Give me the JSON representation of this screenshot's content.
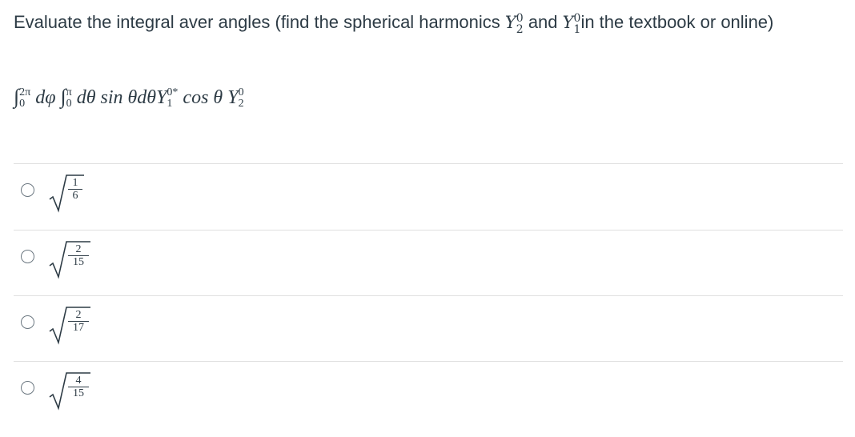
{
  "question": {
    "text_before": "Evaluate the integral aver angles (find the spherical harmonics ",
    "y2": "Y",
    "y2_sup": "0",
    "y2_sub": "2",
    "and": " and ",
    "y1": "Y",
    "y1_sup": "0",
    "y1_sub": "1",
    "text_after": "in the textbook or online)"
  },
  "formula": {
    "int1": "∫",
    "int1_upper": "2π",
    "int1_lower": "0",
    "dphi": " dφ ",
    "int2": "∫",
    "int2_upper": "π",
    "int2_lower": "0",
    "body": " dθ sin θdθY",
    "y1_sup": "0*",
    "y1_sub": "1",
    "cos": " cos θ Y",
    "y2_sup": "0",
    "y2_sub": "2"
  },
  "options": [
    {
      "num": "1",
      "den": "6",
      "selected": false
    },
    {
      "num": "2",
      "den": "15",
      "selected": false
    },
    {
      "num": "2",
      "den": "17",
      "selected": false
    },
    {
      "num": "4",
      "den": "15",
      "selected": false
    }
  ]
}
